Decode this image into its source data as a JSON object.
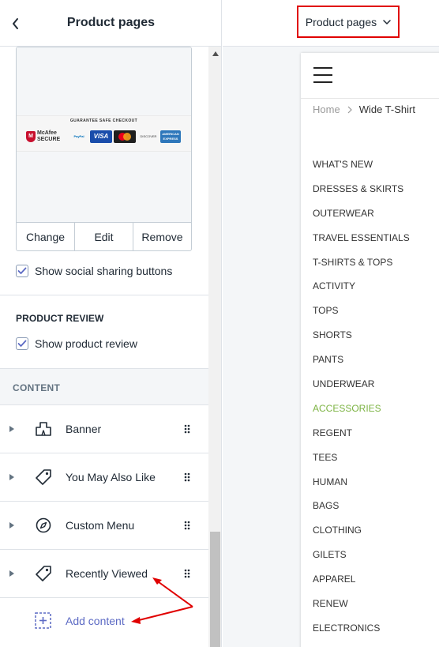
{
  "sidebar": {
    "title": "Product pages",
    "image_card": {
      "safe_checkout_text": "GUARANTEE SAFE CHECKOUT",
      "logos": {
        "mcafee_line1": "McAfee",
        "mcafee_line2": "SECURE",
        "paypal": "PayPal",
        "visa": "VISA",
        "discover": "DISCOVER",
        "amex_line1": "AMERICAN",
        "amex_line2": "EXPRESS"
      },
      "buttons": [
        "Change",
        "Edit",
        "Remove"
      ]
    },
    "show_social_sharing": {
      "label": "Show social sharing buttons",
      "checked": true
    },
    "product_review": {
      "title": "PRODUCT REVIEW",
      "show_review": {
        "label": "Show product review",
        "checked": true
      }
    },
    "content": {
      "title": "CONTENT",
      "blocks": [
        {
          "label": "Banner",
          "icon": "banner-icon"
        },
        {
          "label": "You May Also Like",
          "icon": "tag-icon"
        },
        {
          "label": "Custom Menu",
          "icon": "compass-icon"
        },
        {
          "label": "Recently Viewed",
          "icon": "tag-icon"
        }
      ],
      "add_label": "Add content"
    }
  },
  "preview": {
    "page_selector": "Product pages",
    "breadcrumb": {
      "home": "Home",
      "current": "Wide T-Shirt"
    },
    "menu": [
      "WHAT'S NEW",
      "DRESSES & SKIRTS",
      "OUTERWEAR",
      "TRAVEL ESSENTIALS",
      "T-SHIRTS & TOPS",
      "ACTIVITY",
      "TOPS",
      "SHORTS",
      "PANTS",
      "UNDERWEAR",
      "ACCESSORIES",
      "REGENT",
      "TEES",
      "HUMAN",
      "BAGS",
      "CLOTHING",
      "GILETS",
      "APPAREL",
      "RENEW",
      "ELECTRONICS"
    ],
    "active_menu_item": "ACCESSORIES"
  },
  "colors": {
    "accent": "#5c6ac4",
    "highlight_box": "#e00000",
    "annotation_arrow": "#e00000",
    "active_menu": "#7cb342"
  }
}
